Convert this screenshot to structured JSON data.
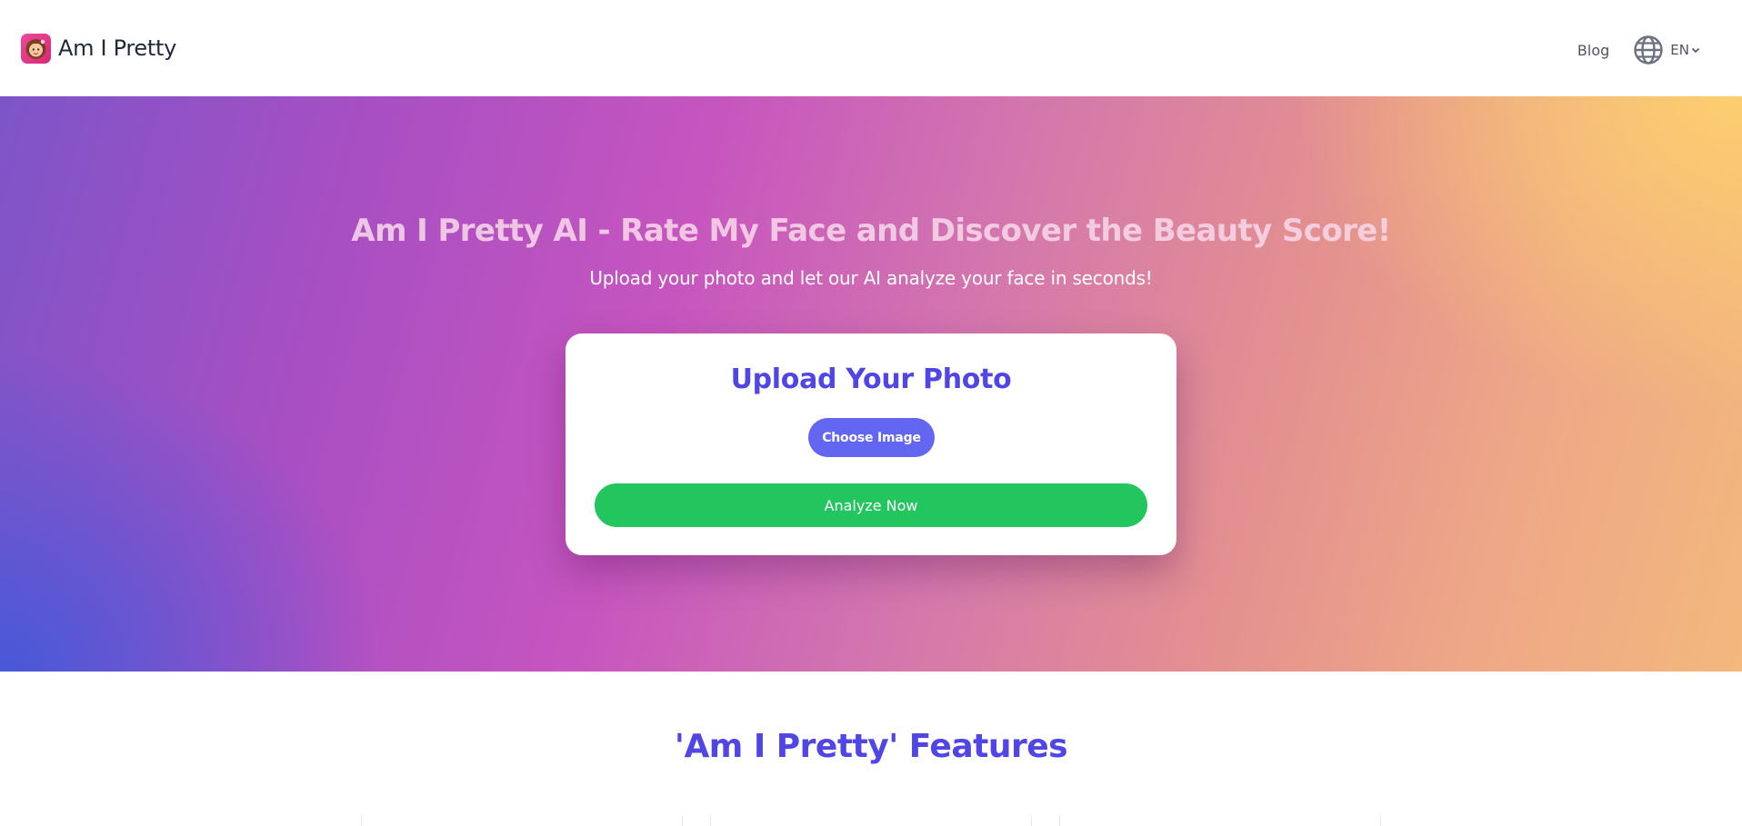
{
  "header": {
    "brand_name": "Am I Pretty",
    "logo_icon": "girl-face-icon",
    "nav": {
      "blog_label": "Blog",
      "language_code": "EN"
    }
  },
  "hero": {
    "title": "Am I Pretty AI - Rate My Face and Discover the Beauty Score!",
    "subtitle": "Upload your photo and let our AI analyze your face in seconds!",
    "upload_card": {
      "title": "Upload Your Photo",
      "choose_label": "Choose Image",
      "analyze_label": "Analyze Now"
    }
  },
  "features": {
    "title": "'Am I Pretty' Features",
    "cards": [
      {},
      {},
      {}
    ]
  },
  "colors": {
    "accent": "#4f46e5",
    "choose_button": "#6366f1",
    "analyze_button": "#22c55e"
  }
}
